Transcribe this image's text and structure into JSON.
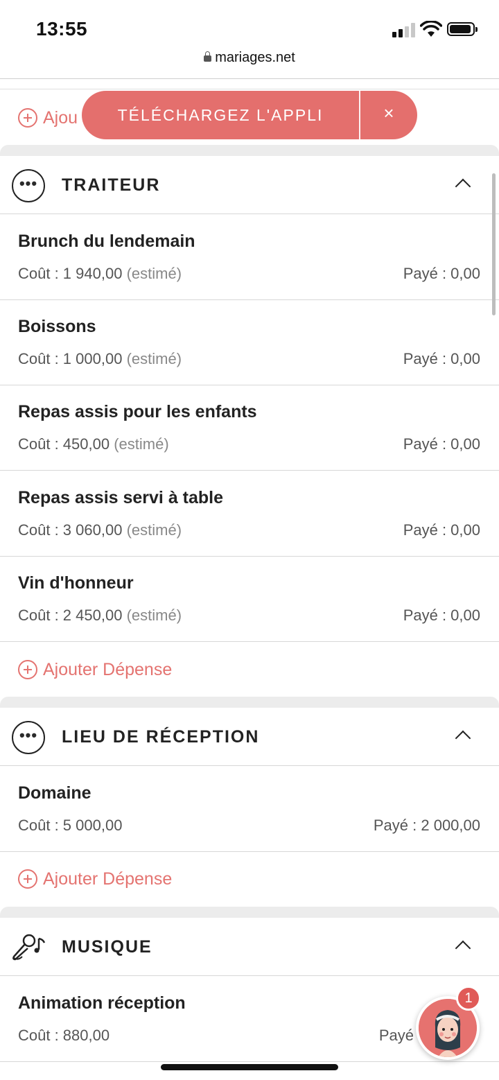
{
  "status": {
    "time": "13:55"
  },
  "browser": {
    "url": "mariages.net"
  },
  "banner": {
    "label": "TÉLÉCHARGEZ L'APPLI",
    "close": "×"
  },
  "add_expense_partial": "Ajou",
  "add_expense_label": "Ajouter Dépense",
  "categories": [
    {
      "title": "TRAITEUR",
      "icon": "more-dots-icon",
      "items": [
        {
          "name": "Brunch du lendemain",
          "cost": "Coût : 1 940,00",
          "estimated": "(estimé)",
          "paid": "Payé : 0,00"
        },
        {
          "name": "Boissons",
          "cost": "Coût : 1 000,00",
          "estimated": "(estimé)",
          "paid": "Payé : 0,00"
        },
        {
          "name": "Repas assis pour les enfants",
          "cost": "Coût : 450,00",
          "estimated": "(estimé)",
          "paid": "Payé : 0,00"
        },
        {
          "name": "Repas assis servi à table",
          "cost": "Coût : 3 060,00",
          "estimated": "(estimé)",
          "paid": "Payé : 0,00"
        },
        {
          "name": "Vin d'honneur",
          "cost": "Coût : 2 450,00",
          "estimated": "(estimé)",
          "paid": "Payé : 0,00"
        }
      ]
    },
    {
      "title": "LIEU DE RÉCEPTION",
      "icon": "more-dots-icon",
      "items": [
        {
          "name": "Domaine",
          "cost": "Coût : 5 000,00",
          "estimated": "",
          "paid": "Payé : 2 000,00"
        }
      ]
    },
    {
      "title": "MUSIQUE",
      "icon": "microphone-music-icon",
      "items": [
        {
          "name": "Animation réception",
          "cost": "Coût : 880,00",
          "estimated": "",
          "paid": "Payé"
        }
      ]
    }
  ],
  "assistant": {
    "badge_count": "1"
  },
  "colors": {
    "accent": "#e47370",
    "banner": "#e46f6d",
    "divider": "#ececec"
  }
}
